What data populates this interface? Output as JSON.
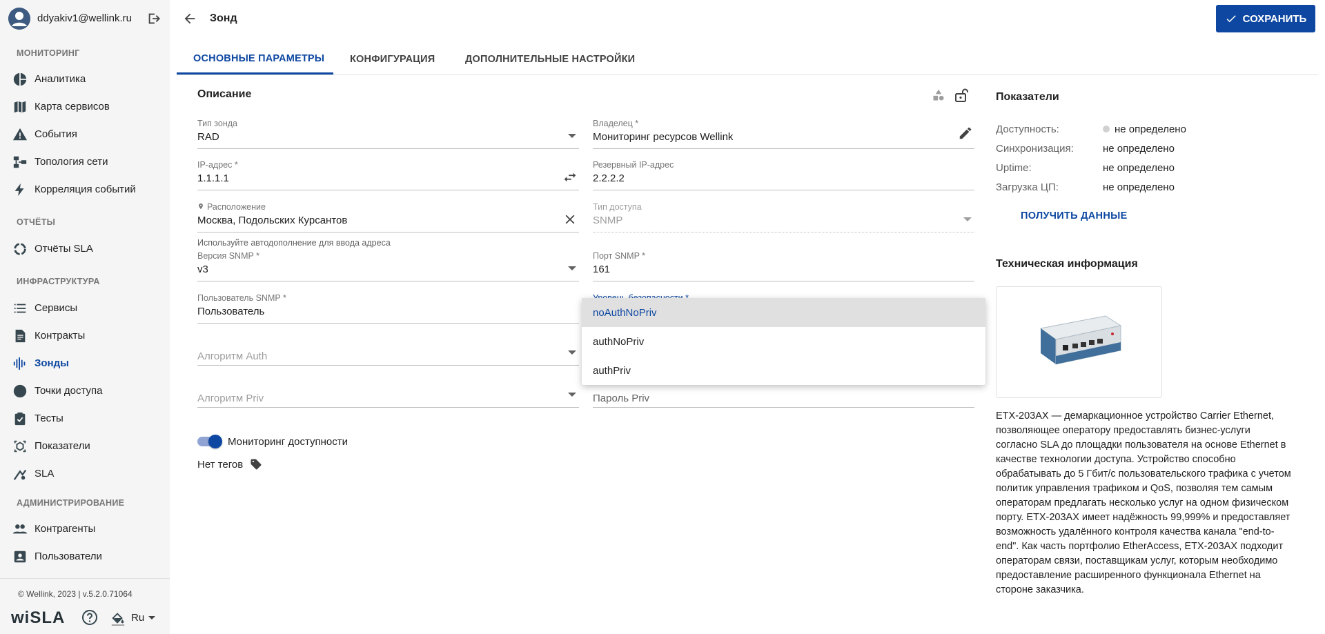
{
  "user": {
    "email": "ddyakiv1@wellink.ru"
  },
  "sidebar": {
    "sections": [
      {
        "title": "МОНИТОРИНГ",
        "items": [
          {
            "label": "Аналитика",
            "icon": "pie-chart-icon"
          },
          {
            "label": "Карта сервисов",
            "icon": "map-icon"
          },
          {
            "label": "События",
            "icon": "warning-icon"
          },
          {
            "label": "Топология сети",
            "icon": "topology-icon"
          },
          {
            "label": "Корреляция событий",
            "icon": "bolt-icon"
          }
        ]
      },
      {
        "title": "ОТЧЁТЫ",
        "items": [
          {
            "label": "Отчёты SLA",
            "icon": "sla-report-icon"
          }
        ]
      },
      {
        "title": "ИНФРАСТРУКТУРА",
        "items": [
          {
            "label": "Сервисы",
            "icon": "list-icon"
          },
          {
            "label": "Контракты",
            "icon": "document-icon"
          },
          {
            "label": "Зонды",
            "icon": "probe-icon"
          },
          {
            "label": "Точки доступа",
            "icon": "access-point-icon"
          },
          {
            "label": "Тесты",
            "icon": "clipboard-check-icon"
          },
          {
            "label": "Показатели",
            "icon": "metrics-icon"
          },
          {
            "label": "SLA",
            "icon": "sla-icon"
          }
        ]
      },
      {
        "title": "АДМИНИСТРИРОВАНИЕ",
        "items": [
          {
            "label": "Контрагенты",
            "icon": "people-icon"
          },
          {
            "label": "Пользователи",
            "icon": "user-card-icon"
          }
        ]
      }
    ],
    "active_item": "Зонды",
    "footer": {
      "copyright": "© Wellink, 2023 | v.5.2.0.71064",
      "logo": "wiSLA",
      "language": "Ru"
    }
  },
  "header": {
    "title": "Зонд",
    "save_label": "СОХРАНИТЬ"
  },
  "tabs": [
    {
      "label": "ОСНОВНЫЕ ПАРАМЕТРЫ",
      "active": true
    },
    {
      "label": "КОНФИГУРАЦИЯ",
      "active": false
    },
    {
      "label": "ДОПОЛНИТЕЛЬНЫЕ НАСТРОЙКИ",
      "active": false
    }
  ],
  "form": {
    "section_title": "Описание",
    "probe_type": {
      "label": "Тип зонда",
      "value": "RAD"
    },
    "owner": {
      "label": "Владелец *",
      "value": "Мониторинг ресурсов Wellink"
    },
    "ip": {
      "label": "IP-адрес *",
      "value": "1.1.1.1"
    },
    "backup_ip": {
      "label": "Резервный IP-адрес",
      "value": "2.2.2.2"
    },
    "location": {
      "label": "Расположение",
      "value": "Москва, Подольских Курсантов",
      "helper": "Используйте автодополнение для ввода адреса"
    },
    "access_type": {
      "label": "Тип доступа",
      "value": "SNMP"
    },
    "snmp_version": {
      "label": "Версия SNMP *",
      "value": "v3"
    },
    "snmp_port": {
      "label": "Порт SNMP *",
      "value": "161"
    },
    "snmp_user": {
      "label": "Пользователь SNMP *",
      "value": "Пользователь"
    },
    "security_level": {
      "label": "Уровень безопасности *"
    },
    "auth_algo": {
      "placeholder": "Алгоритм Auth"
    },
    "priv_algo": {
      "placeholder": "Алгоритм Priv"
    },
    "priv_password": {
      "placeholder": "Пароль Priv"
    },
    "monitoring_toggle": {
      "label": "Мониторинг доступности",
      "on": true
    },
    "tags": {
      "label": "Нет тегов"
    }
  },
  "security_dropdown": {
    "options": [
      "noAuthNoPriv",
      "authNoPriv",
      "authPriv"
    ],
    "selected": "noAuthNoPriv"
  },
  "metrics": {
    "title": "Показатели",
    "rows": [
      {
        "label": "Доступность:",
        "value": "не определено"
      },
      {
        "label": "Синхронизация:",
        "value": "не определено"
      },
      {
        "label": "Uptime:",
        "value": "не определено"
      },
      {
        "label": "Загрузка ЦП:",
        "value": "не определено"
      }
    ],
    "get_data_label": "ПОЛУЧИТЬ ДАННЫЕ"
  },
  "tech_info": {
    "title": "Техническая информация",
    "description": "ETX-203AX — демаркационное устройство Carrier Ethernet, позволяющее оператору предоставлять бизнес-услуги согласно SLA до площадки пользователя на основе Ethernet в качестве технологии доступа. Устройство способно обрабатывать до 5 Гбит/с пользовательского трафика с учетом политик управления трафиком и QoS, позволяя тем самым операторам предлагать несколько услуг на одном физическом порту. ETX-203AX имеет надёжность 99,999% и предоставляет возможность удалённого контроля качества канала \"end-to-end\". Как часть портфолио EtherAccess, ETX-203AX подходит операторам связи, поставщикам услуг, которым необходимо предоставление расширенного функционала Ethernet на стороне заказчика."
  },
  "colors": {
    "accent": "#0d47a1",
    "sidebar_bg": "#f5f5f5",
    "dropdown_selected_bg": "#e0e0e0"
  }
}
